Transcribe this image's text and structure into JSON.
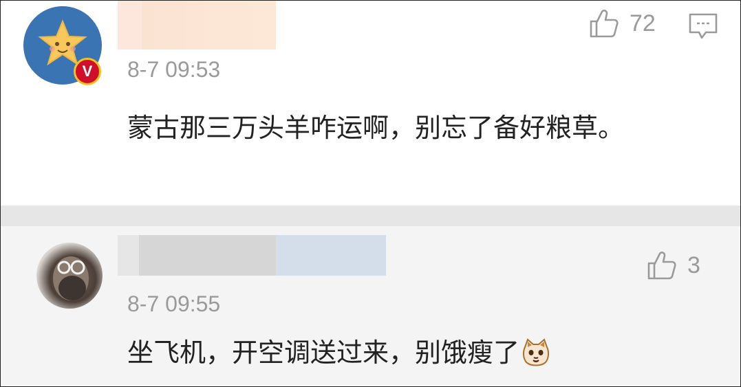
{
  "colors": {
    "timestamp": "#9a9a9a",
    "body_text": "#222222",
    "divider": "#e6e6e6",
    "second_comment_bg": "#f4f4f4",
    "verified_badge": "#d0102a"
  },
  "comments": [
    {
      "avatar_icon": "star-avatar-icon",
      "verified_badge": "V",
      "timestamp": "8-7 09:53",
      "text": "蒙古那三万头羊咋运啊，别忘了备好粮草。",
      "likes": "72",
      "reply_icon": "reply-comment-icon"
    },
    {
      "avatar_icon": "portrait-avatar",
      "timestamp": "8-7 09:55",
      "text": "坐飞机，开空调送过来，别饿瘦了",
      "likes": "3",
      "emoji_icon": "cat-face-emoji-icon"
    }
  ]
}
